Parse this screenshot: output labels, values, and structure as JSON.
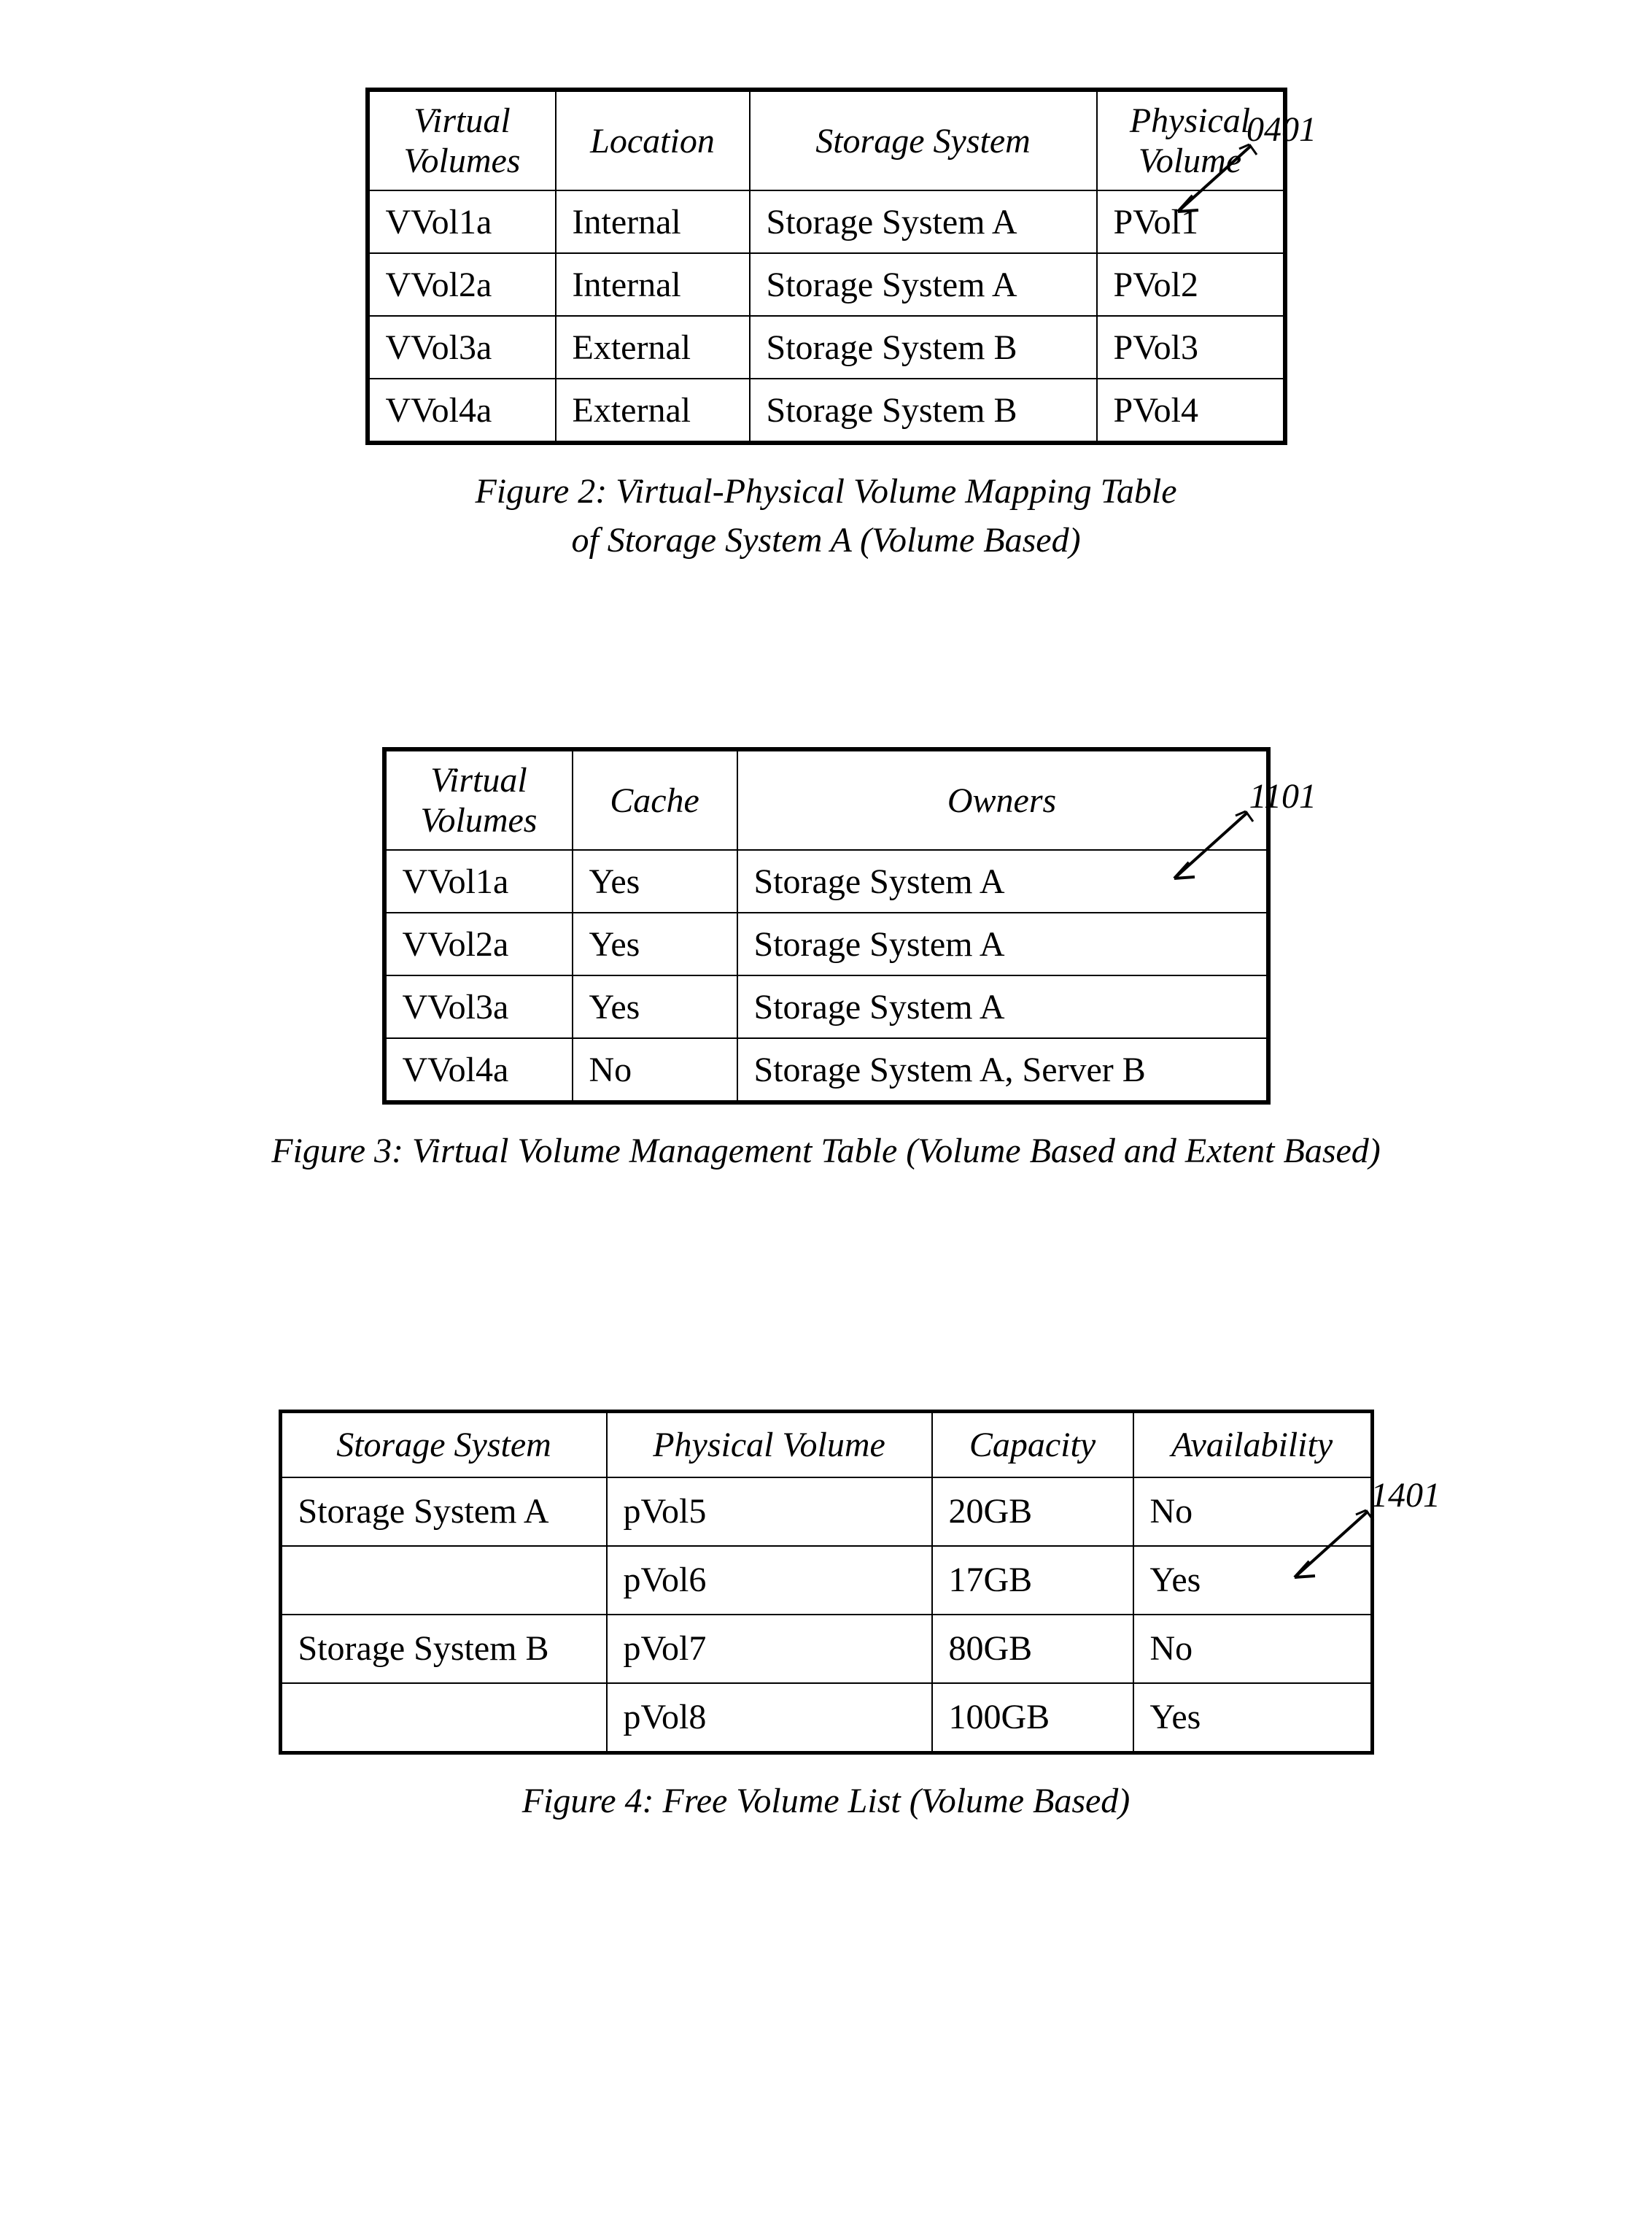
{
  "figure2": {
    "ref": "0401",
    "headers": [
      "Virtual Volumes",
      "Location",
      "Storage System",
      "Physical Volume"
    ],
    "rows": [
      [
        "VVol1a",
        "Internal",
        "Storage System A",
        "PVol1"
      ],
      [
        "VVol2a",
        "Internal",
        "Storage System A",
        "PVol2"
      ],
      [
        "VVol3a",
        "External",
        "Storage System B",
        "PVol3"
      ],
      [
        "VVol4a",
        "External",
        "Storage System B",
        "PVol4"
      ]
    ],
    "caption_line1": "Figure 2: Virtual-Physical Volume Mapping Table",
    "caption_line2": "of Storage System A (Volume Based)"
  },
  "figure3": {
    "ref": "1101",
    "headers": [
      "Virtual Volumes",
      "Cache",
      "Owners"
    ],
    "rows": [
      [
        "VVol1a",
        "Yes",
        "Storage System A"
      ],
      [
        "VVol2a",
        "Yes",
        "Storage System A"
      ],
      [
        "VVol3a",
        "Yes",
        "Storage System A"
      ],
      [
        "VVol4a",
        "No",
        "Storage System A, Server B"
      ]
    ],
    "caption": "Figure 3: Virtual Volume Management Table (Volume Based and Extent Based)"
  },
  "figure4": {
    "ref": "1401",
    "headers": [
      "Storage System",
      "Physical Volume",
      "Capacity",
      "Availability"
    ],
    "rows": [
      [
        "Storage System A",
        "pVol5",
        "20GB",
        "No"
      ],
      [
        "",
        "pVol6",
        "17GB",
        "Yes"
      ],
      [
        "Storage System B",
        "pVol7",
        "80GB",
        "No"
      ],
      [
        "",
        "pVol8",
        "100GB",
        "Yes"
      ]
    ],
    "caption": "Figure 4: Free Volume List (Volume Based)"
  }
}
